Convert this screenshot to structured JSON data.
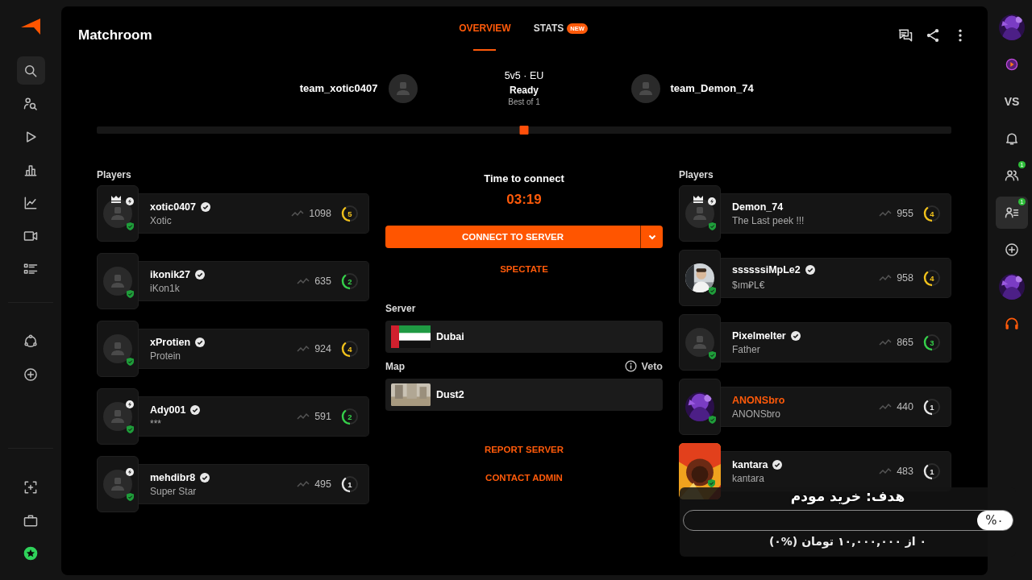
{
  "nav": {
    "top": [
      {
        "selected": true
      },
      {
        "selected": false
      },
      {
        "selected": false
      },
      {
        "selected": false
      },
      {
        "selected": false
      },
      {
        "selected": false
      },
      {
        "selected": false
      }
    ],
    "middle": [
      {
        "selected": false
      },
      {
        "selected": false
      }
    ],
    "bottom": [
      {
        "selected": false
      },
      {
        "selected": false
      },
      {
        "selected": false
      }
    ]
  },
  "header": {
    "title": "Matchroom",
    "tabs": [
      {
        "label": "OVERVIEW",
        "selected": true
      },
      {
        "label": "STATS",
        "badge": "NEW",
        "selected": false
      }
    ]
  },
  "match": {
    "team_left": "team_xotic0407",
    "mode": "5v5 · EU",
    "status": "Ready",
    "format": "Best of 1",
    "team_right": "team_Demon_74"
  },
  "timeline": {
    "level": 0.5
  },
  "left": {
    "heading": "Players",
    "players": [
      {
        "name": "xotic0407",
        "nickname": "Xotic",
        "verified": true,
        "captain": true,
        "boosted": true,
        "avatar": {
          "kind": "default"
        },
        "name_highlighted": false,
        "elo": "1098",
        "ring": {
          "label": "5",
          "color": "#f2c21b"
        }
      },
      {
        "name": "ikonik27",
        "nickname": "iKon1k",
        "verified": true,
        "captain": false,
        "boosted": false,
        "avatar": {
          "kind": "default"
        },
        "name_highlighted": false,
        "elo": "635",
        "ring": {
          "label": "2",
          "color": "#35d14a"
        }
      },
      {
        "name": "xProtien",
        "nickname": "Protein",
        "verified": true,
        "captain": false,
        "boosted": false,
        "avatar": {
          "kind": "default"
        },
        "name_highlighted": false,
        "elo": "924",
        "ring": {
          "label": "4",
          "color": "#f2c21b"
        }
      },
      {
        "name": "Ady001",
        "nickname": "***",
        "verified": true,
        "captain": false,
        "boosted": true,
        "avatar": {
          "kind": "default"
        },
        "name_highlighted": false,
        "elo": "591",
        "ring": {
          "label": "2",
          "color": "#35d14a"
        }
      },
      {
        "name": "mehdibr8",
        "nickname": "Super Star",
        "verified": true,
        "captain": false,
        "boosted": true,
        "avatar": {
          "kind": "default"
        },
        "name_highlighted": false,
        "elo": "495",
        "ring": {
          "label": "1",
          "color": "#e6e6e6"
        }
      }
    ]
  },
  "center": {
    "timer_label": "Time to connect",
    "timer": "03:19",
    "connect_button": "CONNECT TO SERVER",
    "spectate": "SPECTATE",
    "server_label": "Server",
    "server": "Dubai",
    "map_label": "Map",
    "veto": "Veto",
    "map": "Dust2",
    "report": "REPORT SERVER",
    "contact": "CONTACT ADMIN"
  },
  "right": {
    "heading": "Players",
    "players": [
      {
        "name": "Demon_74",
        "nickname": "The Last peek !!!",
        "verified": false,
        "captain": true,
        "boosted": true,
        "avatar": {
          "kind": "default"
        },
        "name_highlighted": false,
        "elo": "955",
        "ring": {
          "label": "4",
          "color": "#f2c21b"
        }
      },
      {
        "name": "ssssssiMpLe2",
        "nickname": "$ım₽L€",
        "verified": true,
        "captain": false,
        "boosted": false,
        "name_highlighted": false,
        "elo": "958",
        "ring": {
          "label": "4",
          "color": "#f2c21b"
        }
      },
      {
        "name": "Pixelmelter",
        "nickname": "Father",
        "verified": true,
        "captain": false,
        "boosted": false,
        "avatar": {
          "kind": "default"
        },
        "name_highlighted": false,
        "elo": "865",
        "ring": {
          "label": "3",
          "color": "#35d14a"
        }
      },
      {
        "name": "ANONSbro",
        "nickname": "ANONSbro",
        "verified": false,
        "captain": false,
        "boosted": false,
        "name_highlighted": true,
        "elo": "440",
        "ring": {
          "label": "1",
          "color": "#e6e6e6"
        }
      },
      {
        "name": "kantara",
        "nickname": "kantara",
        "verified": true,
        "captain": false,
        "boosted": false,
        "avatar": {
          "kind": "banner"
        },
        "name_highlighted": false,
        "elo": "483",
        "ring": {
          "label": "1",
          "color": "#e6e6e6"
        }
      }
    ]
  },
  "goal_widget": {
    "title": "هدف: خرید مودم",
    "percent": "%۰",
    "caption": "۰ از ۱۰,۰۰۰,۰۰۰ تومان (%۰)"
  },
  "rail": [
    {
      "kind": "avatar",
      "selected": false
    },
    {
      "kind": "icon",
      "selected": false
    },
    {
      "kind": "text",
      "label": "VS",
      "selected": false
    },
    {
      "kind": "icon",
      "selected": false
    },
    {
      "kind": "icon",
      "badge": "1",
      "selected": false
    },
    {
      "kind": "icon",
      "badge": "1",
      "selected": true
    },
    {
      "kind": "icon",
      "selected": false
    },
    {
      "kind": "avatar",
      "selected": false
    },
    {
      "kind": "icon",
      "selected": false
    }
  ]
}
